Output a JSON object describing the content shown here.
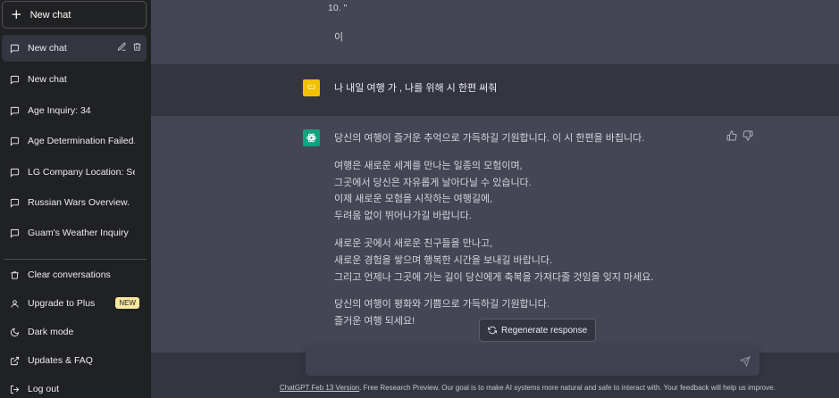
{
  "sidebar": {
    "new_chat_label": "New chat",
    "chats": [
      {
        "label": "New chat",
        "active": true
      },
      {
        "label": "New chat"
      },
      {
        "label": "Age Inquiry: 34"
      },
      {
        "label": "Age Determination Failed."
      },
      {
        "label": "LG Company Location: Seoul"
      },
      {
        "label": "Russian Wars Overview."
      },
      {
        "label": "Guam's Weather Inquiry"
      }
    ],
    "menu": {
      "clear": "Clear conversations",
      "upgrade": "Upgrade to Plus",
      "upgrade_badge": "NEW",
      "dark_mode": "Dark mode",
      "updates": "Updates & FAQ",
      "logout": "Log out"
    }
  },
  "conversation": {
    "prev_line_1": "10.   \"",
    "prev_line_2": "이",
    "user_avatar": "CJ",
    "user_message": "나 내일 여행 가 ,  나를 위해 시 한편 써줘",
    "assistant": {
      "paragraphs": [
        [
          "당신의 여행이 즐거운 추억으로 가득하길 기원합니다. 이 시 한편을 바칩니다."
        ],
        [
          "여행은 새로운 세계를 만나는 일종의 모험이며,",
          "그곳에서 당신은 자유롭게 날아다닐 수 있습니다.",
          "이제 새로운 모험을 시작하는 여행길에,",
          "두려움 없이 뛰어나가길 바랍니다."
        ],
        [
          "새로운 곳에서 새로운 친구들을 만나고,",
          "새로운 경험을 쌓으며 행복한 시간을 보내길 바랍니다.",
          "그리고 언제나 그곳에 가는 길이 당신에게 축복을 가져다줄 것임을 잊지 마세요."
        ],
        [
          "당신의 여행이 평화와 기쁨으로 가득하길 기원합니다.",
          "즐거운 여행 되세요!"
        ]
      ]
    }
  },
  "regenerate_label": "Regenerate response",
  "input": {
    "placeholder": ""
  },
  "footer": {
    "link_text": "ChatGPT Feb 13 Version",
    "text": ". Free Research Preview. Our goal is to make AI systems more natural and safe to interact with. Your feedback will help us improve."
  },
  "colors": {
    "sidebar_bg": "#202123",
    "main_bg": "#343541",
    "assistant_bg": "#444654",
    "brand_green": "#10a37f",
    "user_avatar": "#f2c200",
    "badge": "#fae69e"
  },
  "icons": [
    "plus-icon",
    "chat-bubble-icon",
    "pencil-icon",
    "trash-icon",
    "person-icon",
    "moon-icon",
    "external-link-icon",
    "logout-icon",
    "openai-logo-icon",
    "thumbs-up-icon",
    "thumbs-down-icon",
    "refresh-icon",
    "send-icon"
  ]
}
